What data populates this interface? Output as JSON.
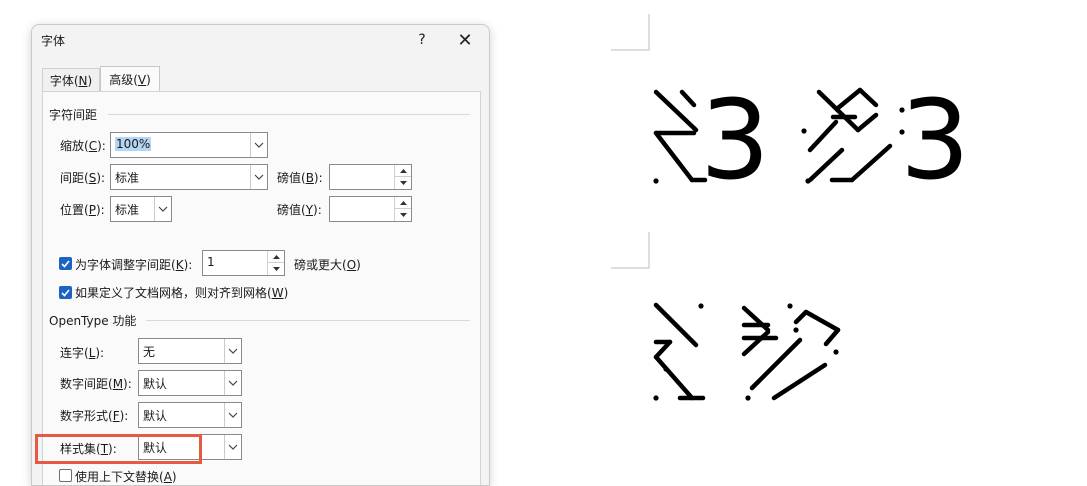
{
  "dialog": {
    "title": "字体",
    "help": "?",
    "close": "✕",
    "tabs": [
      {
        "label": "字体(",
        "key": "N",
        "end": ")"
      },
      {
        "label": "高级(",
        "key": "V",
        "end": ")"
      }
    ],
    "spacing_group": {
      "title": "字符间距",
      "scale": {
        "label": "缩放(",
        "key": "C",
        "end": "):",
        "value": "100%"
      },
      "spacing": {
        "label": "间距(",
        "key": "S",
        "end": "):",
        "value": "标准",
        "by_label": "磅值(",
        "by_key": "B",
        "by_end": "):",
        "by_value": ""
      },
      "position": {
        "label": "位置(",
        "key": "P",
        "end": "):",
        "value": "标准",
        "by_label": "磅值(",
        "by_key": "Y",
        "by_end": "):",
        "by_value": ""
      },
      "kerning": {
        "checked": true,
        "label": "为字体调整字间距(",
        "key": "K",
        "end": "):",
        "value": "1",
        "suffix": "磅或更大(",
        "suffix_key": "O",
        "suffix_end": ")"
      },
      "snap_grid": {
        "checked": true,
        "label": "如果定义了文档网格，则对齐到网格(",
        "key": "W",
        "end": ")"
      }
    },
    "opentype_group": {
      "title": "OpenType 功能",
      "ligatures": {
        "label": "连字(",
        "key": "L",
        "end": "):",
        "value": "无"
      },
      "number_spacing": {
        "label": "数字间距(",
        "key": "M",
        "end": "):",
        "value": "默认"
      },
      "number_forms": {
        "label": "数字形式(",
        "key": "F",
        "end": "):",
        "value": "默认"
      },
      "stylistic_sets": {
        "label": "样式集(",
        "key": "T",
        "end": "):",
        "value": "默认"
      },
      "contextual_alternates": {
        "checked": false,
        "label": "使用上下文替换(",
        "key": "A",
        "end": ")"
      }
    }
  },
  "document": {
    "digit_left_top": "3",
    "digit_right_top": "3"
  },
  "colors": {
    "accent": "#1b64c4",
    "highlight": "#e55a43",
    "glyph": "#000000"
  }
}
